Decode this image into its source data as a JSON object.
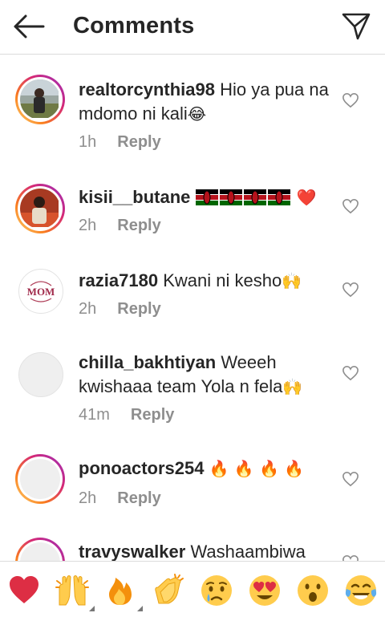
{
  "header": {
    "title": "Comments",
    "back_icon": "arrow-left-icon",
    "send_icon": "paper-plane-icon"
  },
  "comments": [
    {
      "username": "realtorcynthia98",
      "text": "Hio ya pua na mdomo ni kali",
      "emoji": "😂",
      "time": "1h",
      "reply": "Reply",
      "avatar": "photo-woman-field"
    },
    {
      "username": "kisii__butane",
      "text": "",
      "flags": 4,
      "emoji": "❤️",
      "time": "2h",
      "reply": "Reply",
      "avatar": "photo-woman-red"
    },
    {
      "username": "razia7180",
      "text": "Kwani ni kesho",
      "emoji": "🙌",
      "time": "2h",
      "reply": "Reply",
      "avatar": "mom-logo",
      "avatar_text": "MOM"
    },
    {
      "username": "chilla_bakhtiyan",
      "text": "Weeeh kwishaaa team Yola n fela",
      "emoji": "🙌",
      "time": "41m",
      "reply": "Reply",
      "avatar": "blank"
    },
    {
      "username": "ponoactors254",
      "text": "",
      "emoji": "🔥 🔥 🔥 🔥",
      "time": "2h",
      "reply": "Reply",
      "avatar": "blank-ring"
    },
    {
      "username": "travyswalker",
      "text": "Washaambiwa",
      "emoji": "",
      "time": "",
      "reply": "",
      "avatar": "blank-ring"
    }
  ],
  "emoji_bar": [
    {
      "glyph": "❤️",
      "name": "red-heart"
    },
    {
      "glyph": "🙌",
      "name": "raising-hands"
    },
    {
      "glyph": "🔥",
      "name": "fire"
    },
    {
      "glyph": "👏",
      "name": "clapping-hands"
    },
    {
      "glyph": "😢",
      "name": "crying-face"
    },
    {
      "glyph": "😍",
      "name": "heart-eyes"
    },
    {
      "glyph": "😮",
      "name": "surprised-face"
    },
    {
      "glyph": "😂",
      "name": "tears-of-joy"
    }
  ],
  "colors": {
    "text": "#262626",
    "secondary": "#8e8e8e",
    "divider": "#dbdbdb",
    "ring_start": "#feda75",
    "ring_end": "#962fbf"
  }
}
